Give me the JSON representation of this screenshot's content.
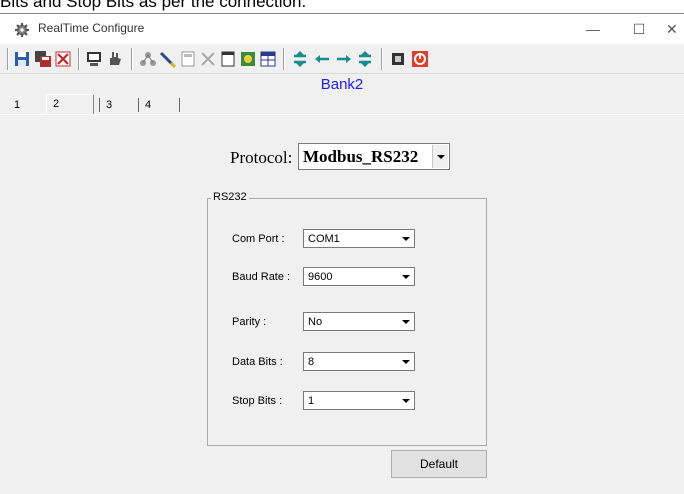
{
  "caption": "Bits and Stop Bits as per the connection.",
  "window": {
    "title": "RealTime Configure",
    "controls": {
      "minimize": "—",
      "maximize": "☐",
      "close": "✕"
    }
  },
  "toolbar": {
    "groups": [
      [
        "save-icon",
        "save-all-icon",
        "delete-icon"
      ],
      [
        "monitor-icon",
        "hand-icon"
      ],
      [
        "network-icon",
        "pencil-icon",
        "calc-icon",
        "tools-icon",
        "document-icon",
        "settings-icon",
        "table-icon"
      ],
      [
        "sort-icon",
        "arrow-left-icon",
        "arrow-right-icon",
        "sort-icon-2"
      ],
      [
        "chip-icon",
        "power-icon"
      ]
    ]
  },
  "bank_title": "Bank2",
  "tabs": [
    {
      "label": "1",
      "selected": false
    },
    {
      "label": "2",
      "selected": true
    },
    {
      "label": "3",
      "selected": false
    },
    {
      "label": "4",
      "selected": false
    }
  ],
  "protocol": {
    "label": "Protocol:",
    "value": "Modbus_RS232"
  },
  "rs232": {
    "title": "RS232",
    "fields": [
      {
        "label": "Com Port :",
        "value": "COM1"
      },
      {
        "label": "Baud Rate :",
        "value": "9600"
      },
      {
        "label": "Parity :",
        "value": "No"
      },
      {
        "label": "Data Bits :",
        "value": "8"
      },
      {
        "label": "Stop Bits :",
        "value": "1"
      }
    ]
  },
  "default_button": "Default",
  "colors": {
    "bank_title": "#1a1aff",
    "toolbar_arrows": "#1a8c8c",
    "power_red": "#e83a2a"
  }
}
